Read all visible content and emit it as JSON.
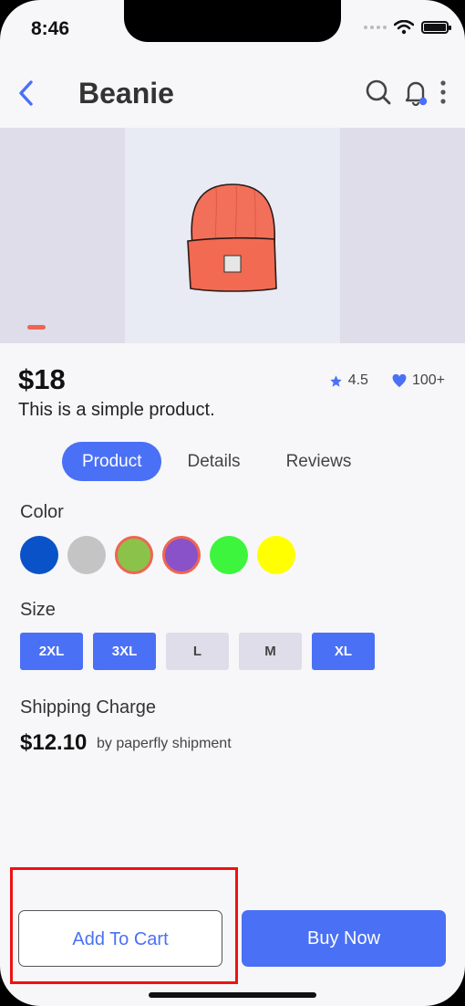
{
  "status": {
    "time": "8:46"
  },
  "header": {
    "title": "Beanie",
    "back_icon": "chevron-left-icon",
    "search_icon": "search-icon",
    "bell_icon": "bell-icon",
    "more_icon": "more-vertical-icon",
    "accent": "#4a70f5"
  },
  "product": {
    "price": "$18",
    "description": "This is a simple product.",
    "rating": "4.5",
    "likes": "100+",
    "gallery_page": 1
  },
  "tabs": [
    {
      "label": "Product",
      "active": true
    },
    {
      "label": "Details",
      "active": false
    },
    {
      "label": "Reviews",
      "active": false
    }
  ],
  "color": {
    "label": "Color",
    "swatches": [
      {
        "hex": "#0a52c8",
        "selected": false
      },
      {
        "hex": "#c4c4c4",
        "selected": false
      },
      {
        "hex": "#8bc34a",
        "selected": true
      },
      {
        "hex": "#8a52c9",
        "selected": true
      },
      {
        "hex": "#3df53d",
        "selected": false
      },
      {
        "hex": "#ffff00",
        "selected": false
      }
    ]
  },
  "size": {
    "label": "Size",
    "options": [
      {
        "label": "2XL",
        "selected": true
      },
      {
        "label": "3XL",
        "selected": true
      },
      {
        "label": "L",
        "selected": false
      },
      {
        "label": "M",
        "selected": false
      },
      {
        "label": "XL",
        "selected": true
      }
    ]
  },
  "shipping": {
    "label": "Shipping Charge",
    "price": "$12.10",
    "note": "by paperfly shipment"
  },
  "actions": {
    "add_to_cart": "Add To Cart",
    "buy_now": "Buy Now"
  },
  "colors": {
    "accent": "#4a70f5",
    "highlight": "#ee1111",
    "pager": "#ef6552"
  }
}
